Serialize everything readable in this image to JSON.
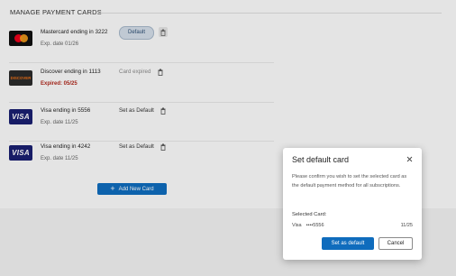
{
  "section": {
    "title": "MANAGE PAYMENT CARDS"
  },
  "cards": [
    {
      "brand": "Mastercard",
      "logo_text": "",
      "name": "Mastercard ending in 3222",
      "expiry": "Exp. date 01/26",
      "action": "Default",
      "expired": false
    },
    {
      "brand": "Discover",
      "logo_text": "DISCOVER",
      "name": "Discover ending in 1113",
      "expiry": "Expired: 05/25",
      "action": "Card expired",
      "expired": true
    },
    {
      "brand": "Visa",
      "logo_text": "VISA",
      "name": "Visa ending in 5556",
      "expiry": "Exp. date 11/25",
      "action": "Set as Default",
      "expired": false
    },
    {
      "brand": "Visa",
      "logo_text": "VISA",
      "name": "Visa ending in 4242",
      "expiry": "Exp. date 11/25",
      "action": "Set as Default",
      "expired": false
    }
  ],
  "add_button": {
    "label": "Add New Card"
  },
  "dialog": {
    "title": "Set default card",
    "message": "Please confirm you wish to set the selected card as the default payment method for all subscriptions.",
    "selected_label": "Selected Card:",
    "selected_brand": "Visa",
    "selected_number": "••••5556",
    "selected_expiry": "11/25",
    "confirm_label": "Set as default",
    "cancel_label": "Cancel"
  },
  "icons": {
    "trash": "trash-icon",
    "close": "close-icon",
    "plus": "plus-icon"
  },
  "colors": {
    "accent": "#0f6cbd",
    "expired": "#b0281c",
    "default_pill": "#d3dde8"
  }
}
